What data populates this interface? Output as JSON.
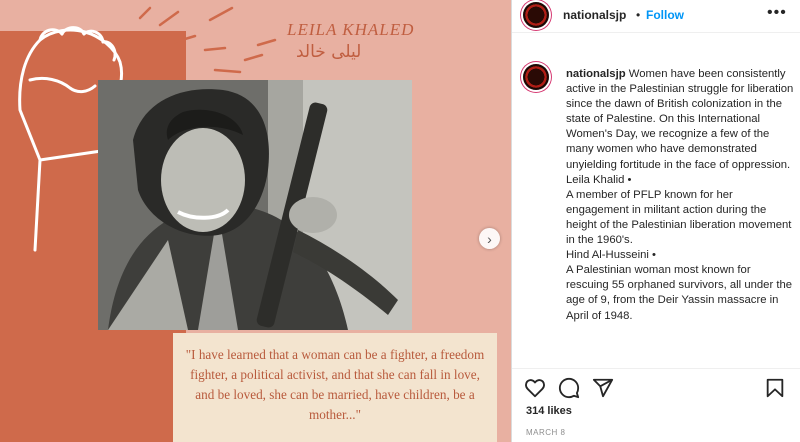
{
  "post": {
    "title": "LEILA KHALED",
    "title_arabic": "ليلى خالد",
    "quote": "\"I have learned that a woman can be a fighter, a freedom fighter, a political activist, and that she can fall in love, and be loved, she can be married, have children, be a mother...\""
  },
  "nav": {
    "next_icon": "›"
  },
  "header": {
    "username": "nationalsjp",
    "separator": "•",
    "follow_label": "Follow",
    "more_label": "•••"
  },
  "caption": {
    "username": "nationalsjp",
    "lines": [
      "Women have been consistently active in the Palestinian struggle for liberation since the dawn of British colonization in the state of Palestine. On this International Women's Day, we recognize a few of the many women who have demonstrated unyielding fortitude in the face of oppression.",
      "Leila Khalid •",
      "A member of PFLP known for her engagement in militant action during the height of the Palestinian liberation movement in the 1960's.",
      "Hind Al-Husseini •",
      "A Palestinian woman most known for rescuing 55 orphaned survivors, all under the age of 9, from the Deir Yassin massacre in April of 1948."
    ]
  },
  "stats": {
    "likes": "314 likes",
    "date": "MARCH 8"
  },
  "colors": {
    "accent": "#0095f6",
    "brand_bg": "#e8b0a1",
    "orange": "#cf6a4b",
    "quote_box": "#f3e4cf"
  },
  "icons": [
    "heart-icon",
    "comment-icon",
    "share-icon",
    "bookmark-icon",
    "raised-fist-icon",
    "chevron-right-icon"
  ]
}
